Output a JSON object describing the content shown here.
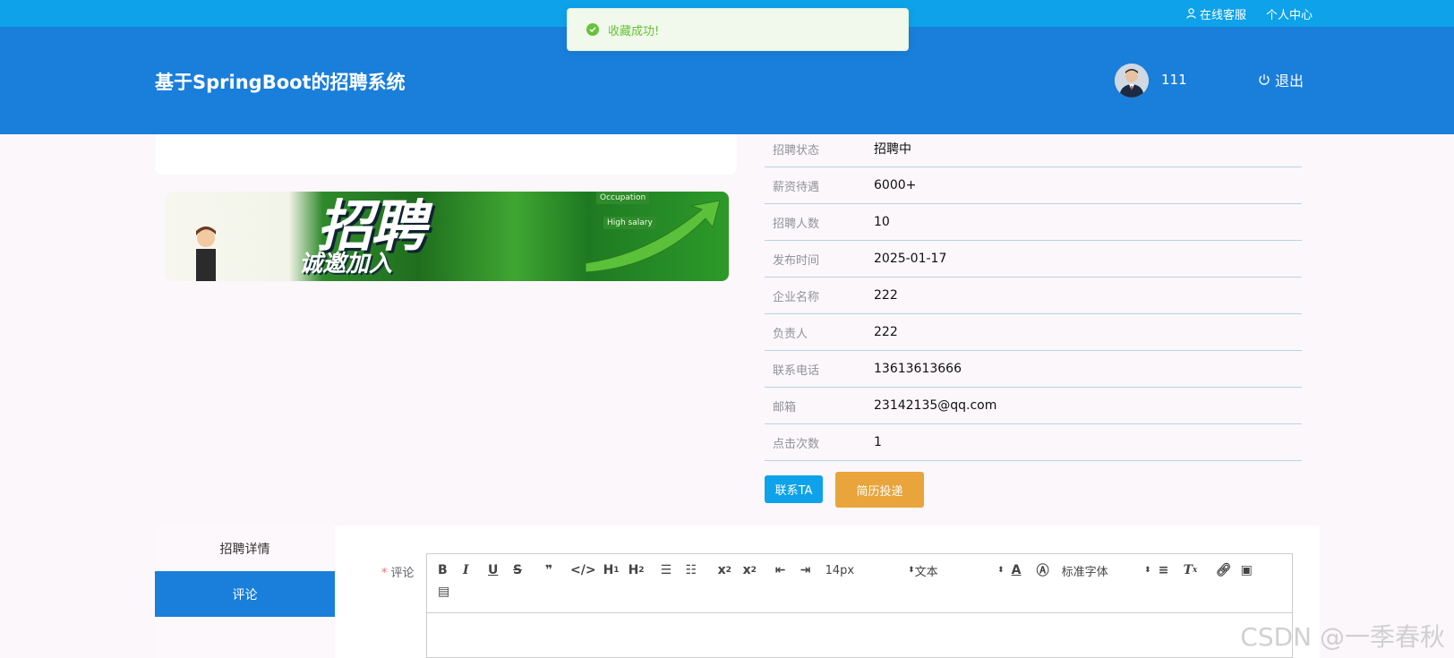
{
  "topbar": {
    "service_label": "在线客服",
    "profile_label": "个人中心"
  },
  "toast": {
    "message": "收藏成功!"
  },
  "header": {
    "title": "基于SpringBoot的招聘系统",
    "username": "111",
    "logout_label": "退出"
  },
  "banner": {
    "big_text": "招聘",
    "cn_text": "诚邀加入",
    "tag1": "Occupation",
    "tag2": "High salary"
  },
  "info": {
    "rows": [
      {
        "label": "招聘状态",
        "value": "招聘中"
      },
      {
        "label": "薪资待遇",
        "value": "6000+"
      },
      {
        "label": "招聘人数",
        "value": "10"
      },
      {
        "label": "发布时间",
        "value": "2025-01-17"
      },
      {
        "label": "企业名称",
        "value": "222"
      },
      {
        "label": "负责人",
        "value": "222"
      },
      {
        "label": "联系电话",
        "value": "13613613666"
      },
      {
        "label": "邮箱",
        "value": "23142135@qq.com"
      },
      {
        "label": "点击次数",
        "value": "1"
      }
    ]
  },
  "actions": {
    "contact_label": "联系TA",
    "apply_label": "简历投递"
  },
  "tabs": {
    "detail_label": "招聘详情",
    "comment_label": "评论"
  },
  "form": {
    "required_mark": "*",
    "comment_label": "评论"
  },
  "editor": {
    "font_size": "14px",
    "header_select": "文本",
    "font_family": "标准字体"
  },
  "watermark": "CSDN @一季春秋",
  "colors": {
    "topbar": "#0ea2ea",
    "header": "#1a7edb",
    "apply_button": "#e9a43c",
    "success": "#67c23a"
  }
}
